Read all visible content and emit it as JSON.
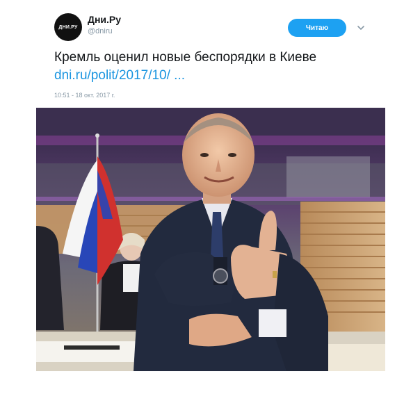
{
  "account": {
    "name": "Дни.Ру",
    "handle": "@dniru",
    "avatar_text": "ДНИ.РУ"
  },
  "follow_button": {
    "label": "Читаю"
  },
  "tweet": {
    "text": "Кремль оценил новые беспорядки в Киеве",
    "link": "dni.ru/polit/2017/10/ ...",
    "timestamp": "10:51 - 18 окт. 2017 г."
  },
  "colors": {
    "accent": "#1da1f2",
    "link": "#1b95e0",
    "muted": "#8899a6"
  },
  "icons": {
    "menu": "chevron-down-icon"
  }
}
